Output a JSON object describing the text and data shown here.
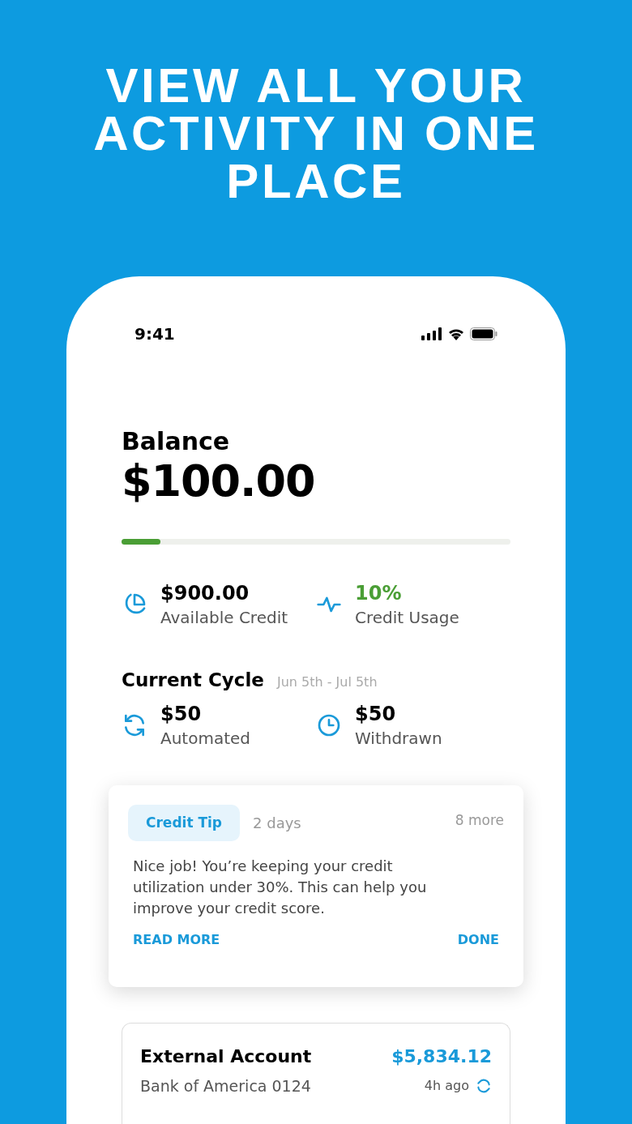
{
  "headline": "VIEW ALL YOUR ACTIVITY IN ONE PLACE",
  "status_bar": {
    "time": "9:41"
  },
  "balance": {
    "label": "Balance",
    "amount": "$100.00",
    "level": 0.1
  },
  "stats": [
    {
      "kind": "pie",
      "value": "$900.00",
      "label": "Available Credit",
      "positive": false
    },
    {
      "kind": "pulse",
      "value": "10%",
      "label": "Credit Usage",
      "positive": true
    }
  ],
  "cycle": {
    "title": "Current Cycle",
    "range": "Jun 5th - Jul 5th",
    "items": [
      {
        "kind": "sync",
        "value": "$50",
        "label": "Automated"
      },
      {
        "kind": "clock",
        "value": "$50",
        "label": "Withdrawn"
      }
    ]
  },
  "tip": {
    "tag": "Credit Tip",
    "age": "2 days",
    "more": "8 more",
    "text": "Nice job! You’re keeping your credit utilization under 30%. This can help you improve your credit score.",
    "actions": [
      "READ MORE",
      "DONE"
    ]
  },
  "account": {
    "title": "External Account",
    "amount": "$5,834.12",
    "bank": "Bank of America 0124",
    "updated": "4h ago"
  }
}
